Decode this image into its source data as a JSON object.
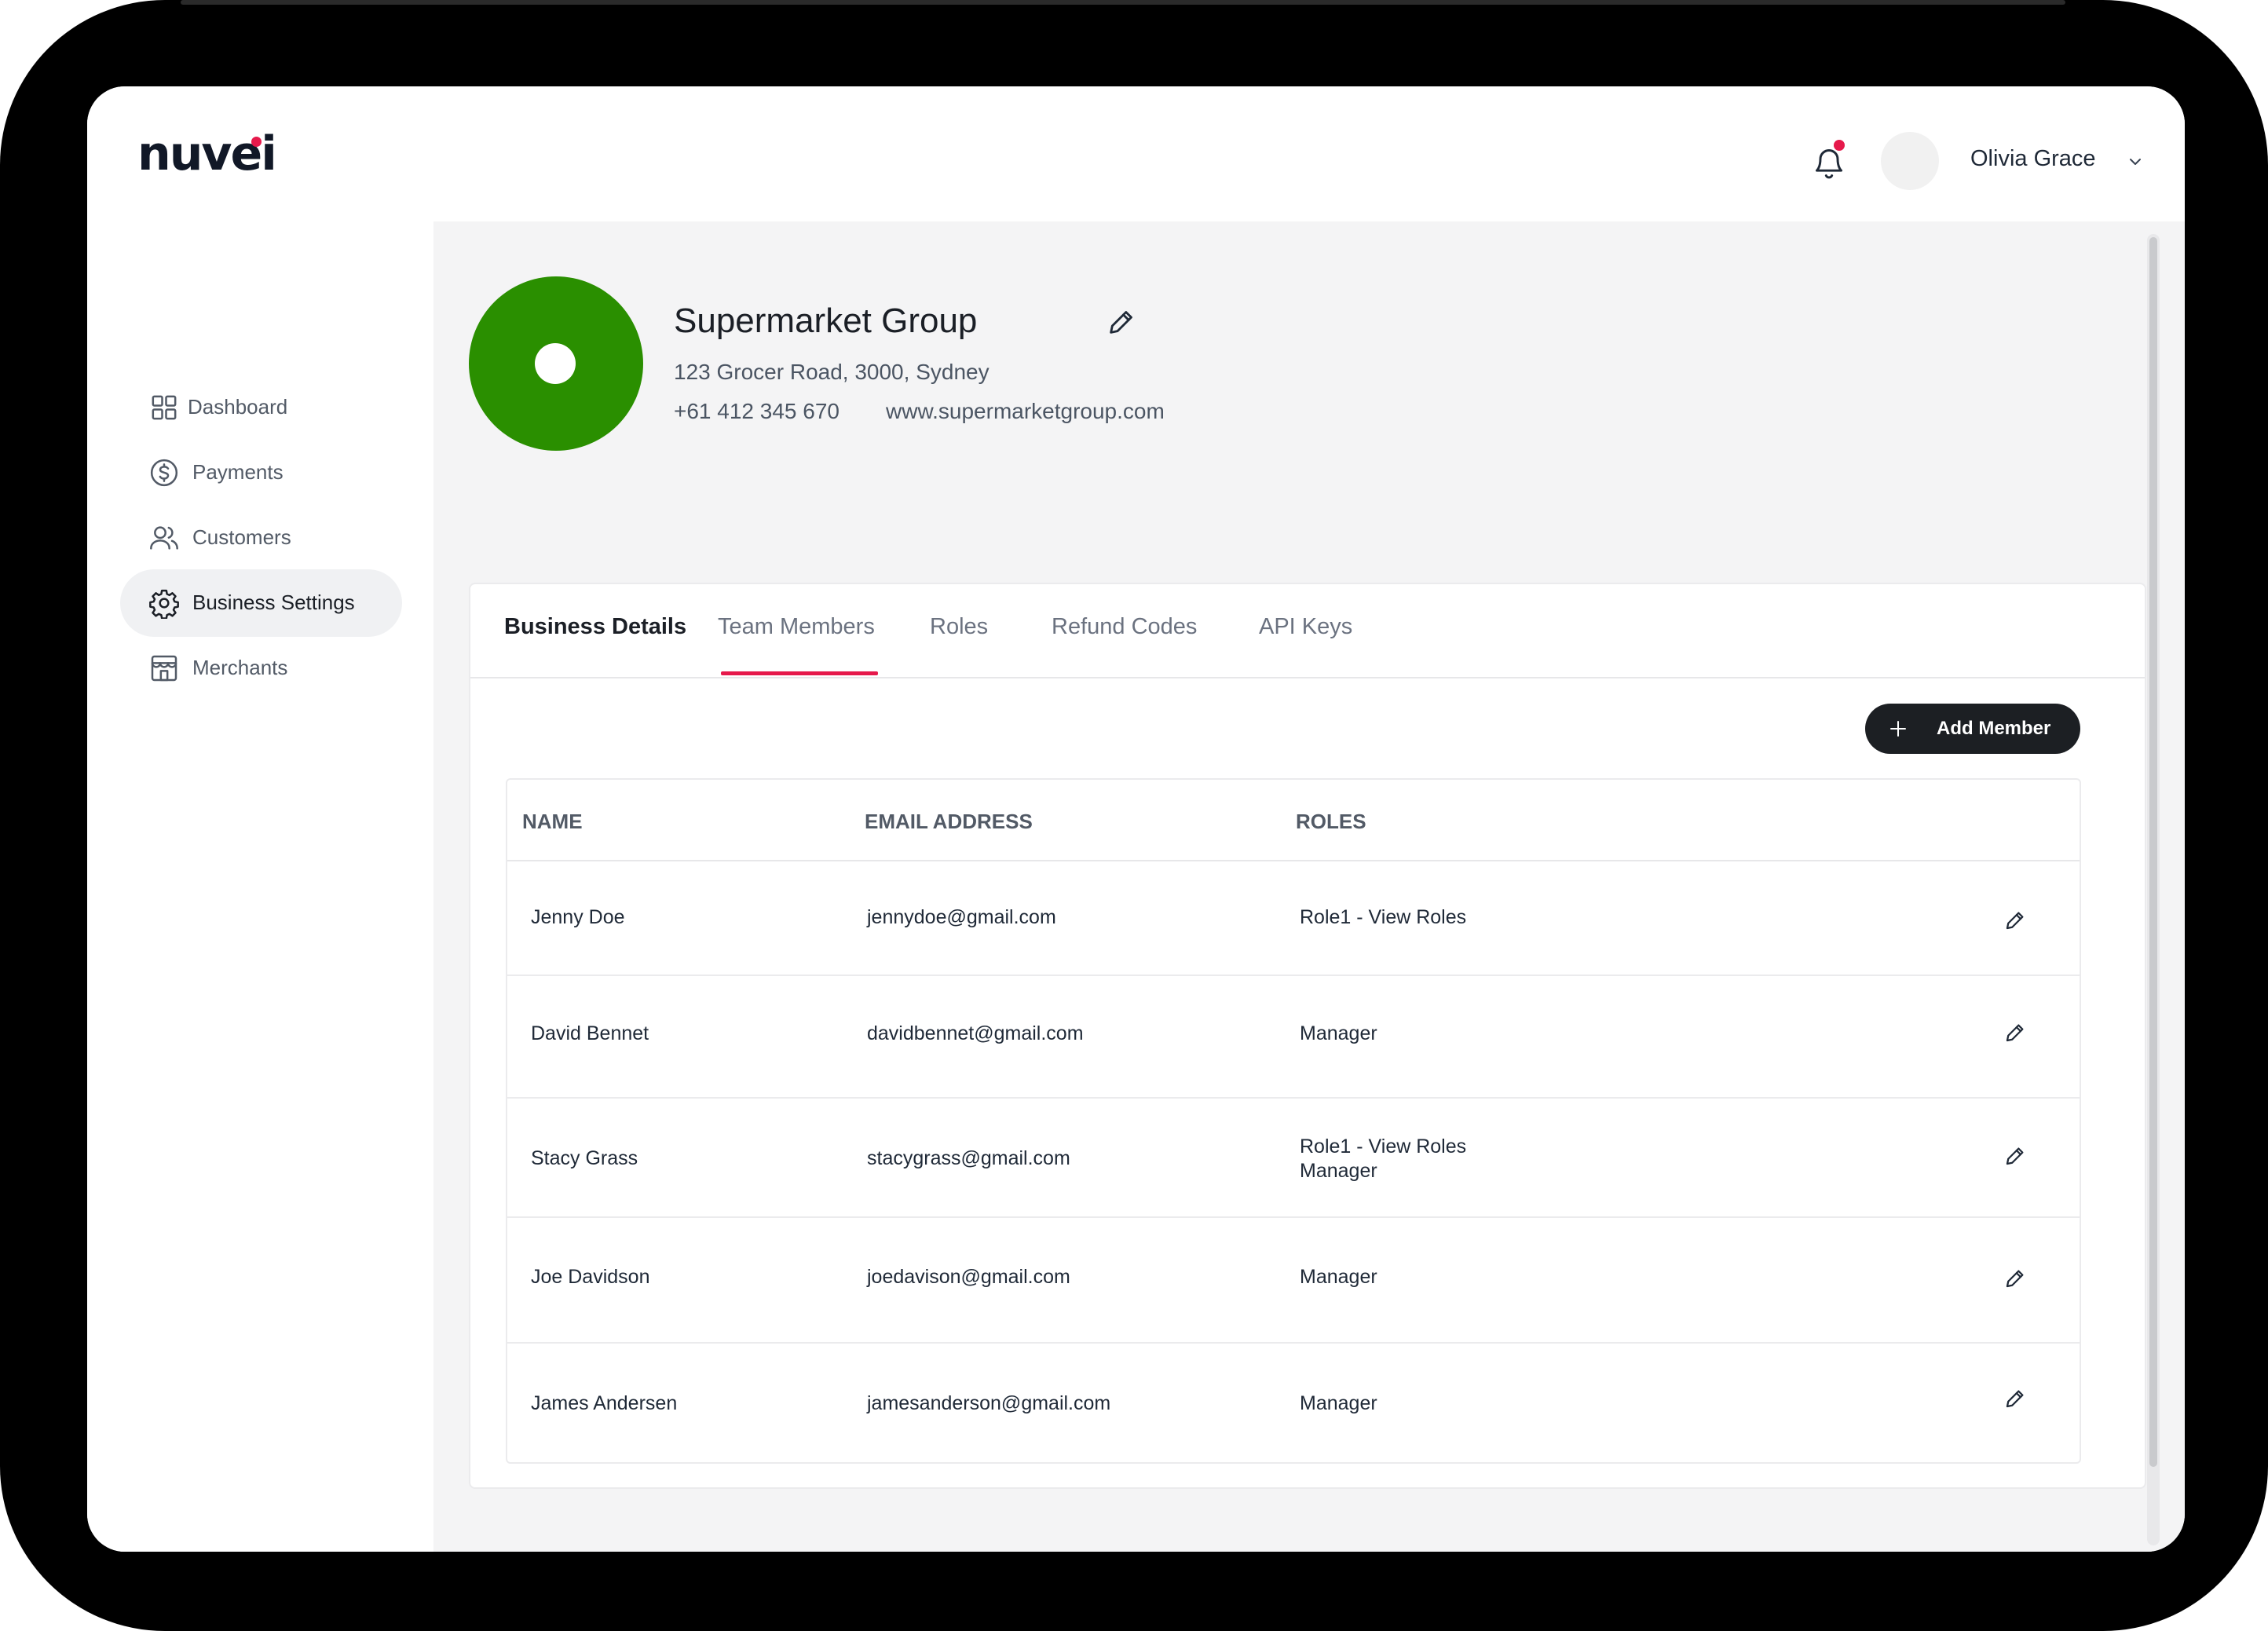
{
  "header": {
    "logo_text": "nuvei",
    "user_name": "Olivia Grace",
    "notification_dot_color": "#e6194b"
  },
  "sidebar": {
    "items": [
      {
        "label": "Dashboard",
        "icon": "grid-icon",
        "active": false
      },
      {
        "label": "Payments",
        "icon": "dollar-circle-icon",
        "active": false
      },
      {
        "label": "Customers",
        "icon": "users-icon",
        "active": false
      },
      {
        "label": "Business Settings",
        "icon": "gear-icon",
        "active": true
      },
      {
        "label": "Merchants",
        "icon": "store-icon",
        "active": false
      }
    ]
  },
  "business": {
    "name": "Supermarket Group",
    "address": "123 Grocer Road, 3000, Sydney",
    "phone": "+61 412 345 670",
    "website": "www.supermarketgroup.com",
    "avatar_color": "#2a8f00"
  },
  "tabs": [
    {
      "label": "Business Details"
    },
    {
      "label": "Team Members",
      "active": true
    },
    {
      "label": "Roles"
    },
    {
      "label": "Refund Codes"
    },
    {
      "label": "API Keys"
    }
  ],
  "actions": {
    "add_member_label": "Add Member"
  },
  "table": {
    "columns": [
      "NAME",
      "EMAIL ADDRESS",
      "ROLES"
    ],
    "rows": [
      {
        "name": "Jenny Doe",
        "email": "jennydoe@gmail.com",
        "roles": [
          "Role1 - View Roles"
        ]
      },
      {
        "name": "David Bennet",
        "email": "davidbennet@gmail.com",
        "roles": [
          "Manager"
        ]
      },
      {
        "name": "Stacy Grass",
        "email": "stacygrass@gmail.com",
        "roles": [
          "Role1 - View Roles",
          "Manager"
        ]
      },
      {
        "name": "Joe Davidson",
        "email": "joedavison@gmail.com",
        "roles": [
          "Manager"
        ]
      },
      {
        "name": "James Andersen",
        "email": "jamesanderson@gmail.com",
        "roles": [
          "Manager"
        ]
      }
    ]
  },
  "colors": {
    "accent": "#e6194b",
    "button_dark": "#1c1f23",
    "page_bg": "#f4f4f5"
  }
}
